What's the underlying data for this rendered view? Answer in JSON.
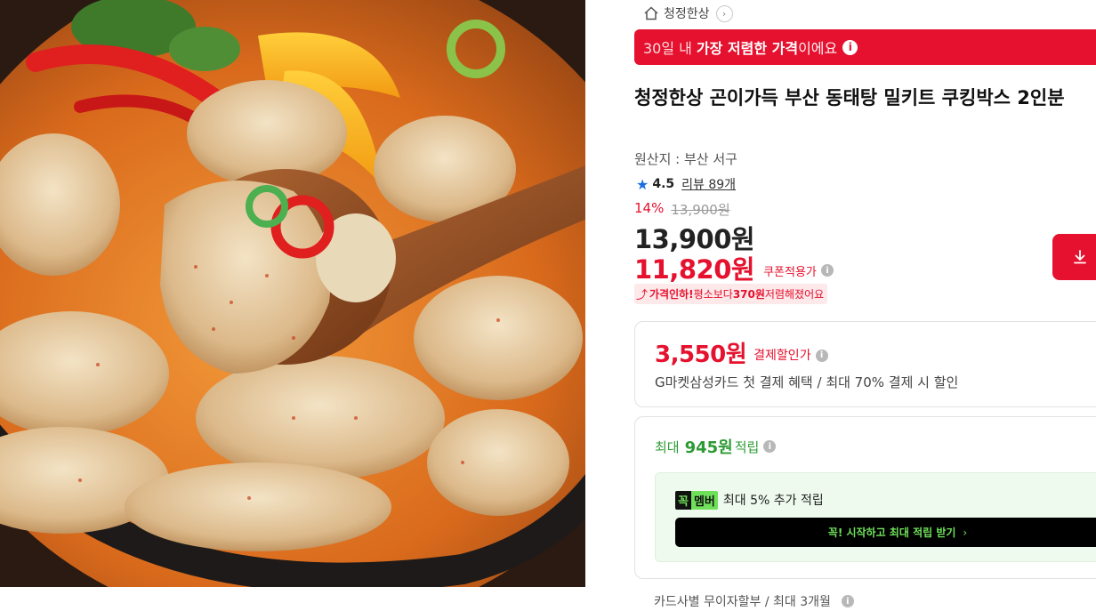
{
  "product": {
    "image_alt": "",
    "shop_name": "청정한상",
    "lowest_banner": {
      "prefix": "30일 내",
      "emphasis": "가장 저렴한 가격",
      "suffix": "이에요"
    },
    "title": "청정한상 곤이가득 부산 동태탕 밀키트 쿠킹박스 2인분",
    "origin": "원산지 : 부산 서구",
    "rating": "4.5",
    "review_label": "리뷰 89개",
    "discount_percent": "14%",
    "original_price": "13,900원",
    "price": "13,900원",
    "coupon_price": "11,820원",
    "coupon_label": "쿠폰적용가",
    "price_drop": {
      "lead": "가격인하!",
      "rest": " 평소보다 ",
      "amount": "370원",
      "tail": " 저렴해졌어요"
    },
    "download_icon": "download-icon"
  },
  "payment_discount": {
    "amount": "3,550원",
    "label": "결제할인가",
    "description": "G마켓삼성카드 첫 결제 혜택 / 최대 70% 결제 시 할인"
  },
  "points": {
    "prefix": "최대",
    "amount": "945원",
    "suffix": "적립",
    "member_badge_left": "꼭",
    "member_badge_right": "멤버",
    "member_text": "최대 5% 추가 적립",
    "start_button": "꼭! 시작하고 최대 적립 받기"
  },
  "installment": "카드사별 무이자할부 / 최대 3개월",
  "colors": {
    "accent_red": "#e5112e",
    "points_green": "#2c9b33",
    "member_green": "#6fe05a",
    "rating_blue": "#1a6ee0"
  }
}
